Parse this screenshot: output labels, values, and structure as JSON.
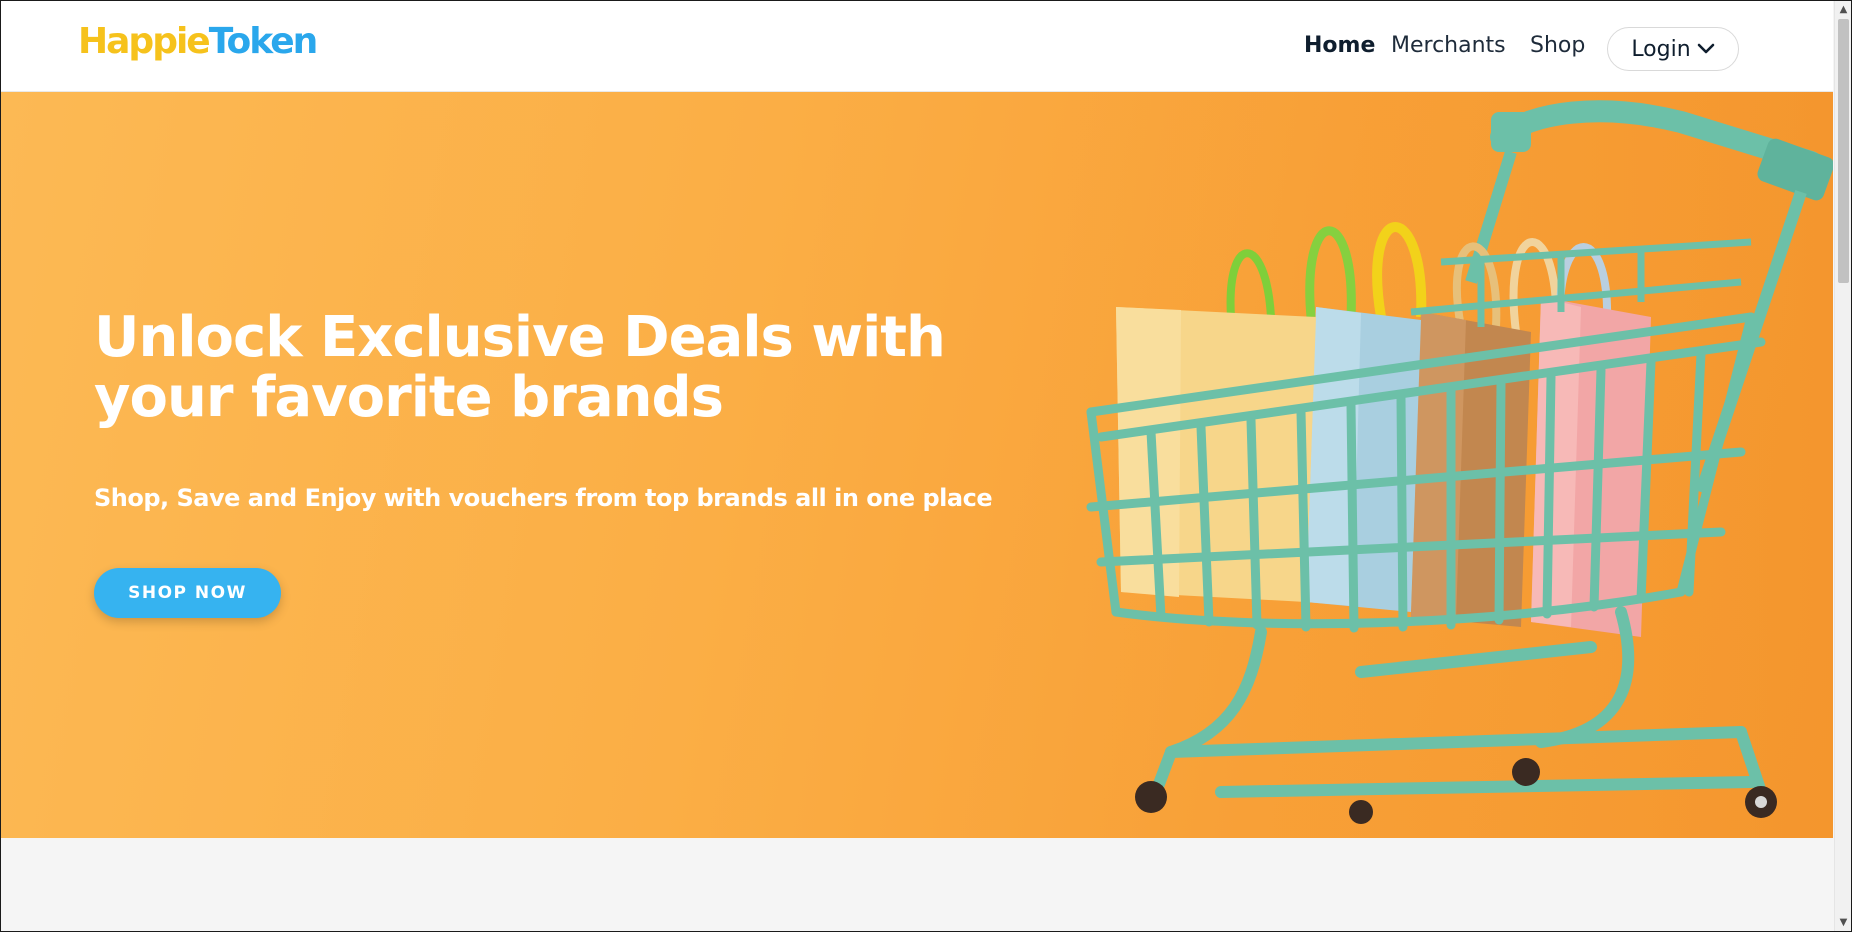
{
  "header": {
    "logo_part1": "Happie",
    "logo_part2": "Token",
    "nav": {
      "home": "Home",
      "merchants": "Merchants",
      "shop": "Shop"
    },
    "login_label": "Login"
  },
  "hero": {
    "title_line1": "Unlock Exclusive Deals with",
    "title_line2": "your favorite brands",
    "subtitle": "Shop, Save and Enjoy with vouchers from top brands all in one place",
    "cta_label": "SHOP NOW"
  },
  "colors": {
    "logo_yellow": "#f6c21c",
    "logo_blue": "#2aa7ec",
    "hero_orange": "#fbae45",
    "cta_blue": "#36b3f0",
    "cart_teal": "#6cc0a8"
  },
  "icons": {
    "login_dropdown": "chevron-down-icon",
    "scroll_up": "arrow-up-icon",
    "scroll_down": "arrow-down-icon"
  }
}
